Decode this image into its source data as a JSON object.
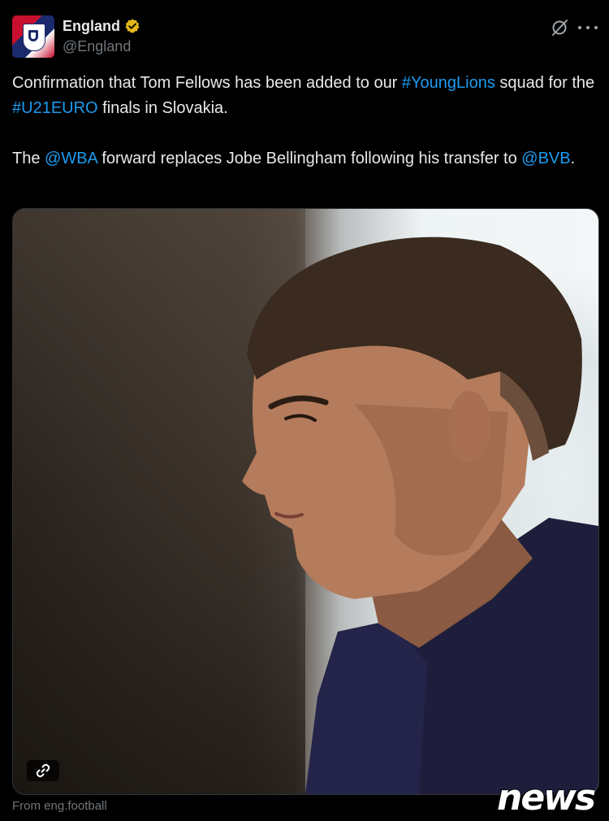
{
  "account": {
    "name": "England",
    "handle": "@England",
    "verified": true,
    "verified_color": "#e2b719"
  },
  "tweet": {
    "p1_part1": "Confirmation that Tom Fellows has been added to our ",
    "p1_hashtag1": "#YoungLions",
    "p1_part2": " squad for the ",
    "p1_hashtag2": "#U21EURO",
    "p1_part3": " finals in Slovakia.",
    "p2_part1": "The ",
    "p2_mention1": "@WBA",
    "p2_part2": " forward replaces Jobe Bellingham following his transfer to ",
    "p2_mention2": "@BVB",
    "p2_part3": "."
  },
  "link_color": "#1d9bf0",
  "media": {
    "icon": "link-icon"
  },
  "source": {
    "label": "From eng.football"
  },
  "watermark": {
    "text": "news"
  },
  "icons": {
    "grok": "grok-icon",
    "more": "more-icon",
    "verified": "verified-badge-icon"
  }
}
